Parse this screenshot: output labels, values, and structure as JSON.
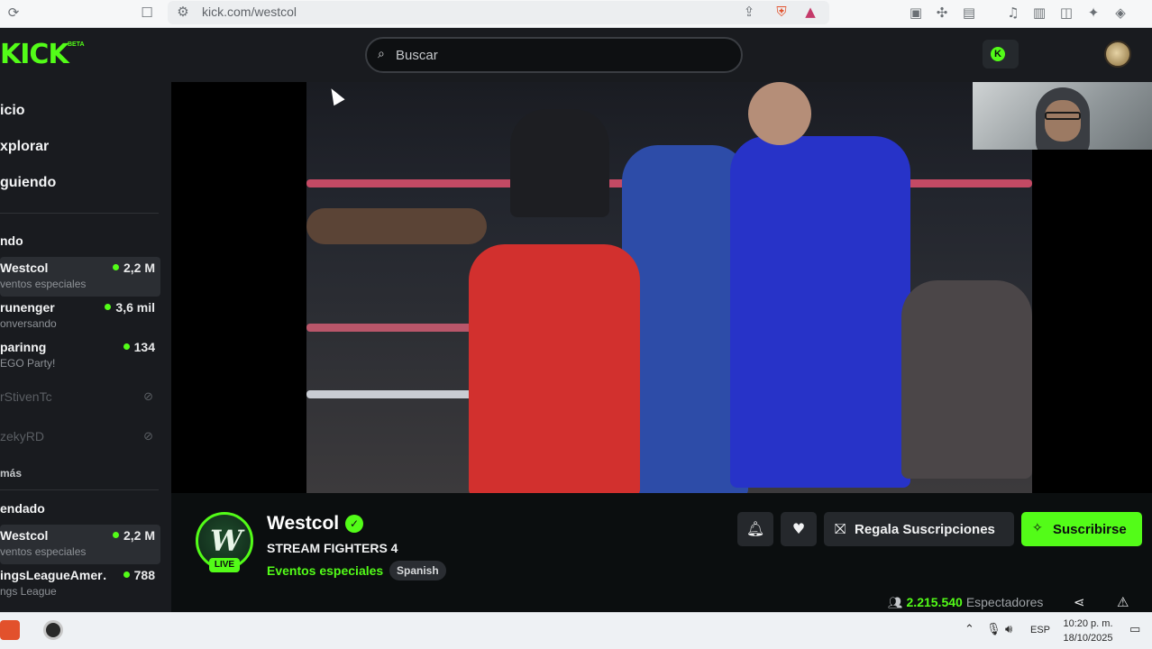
{
  "browser": {
    "url": "kick.com/westcol",
    "icons": [
      "reload-icon",
      "bookmark-icon",
      "site-settings-icon",
      "share-icon",
      "brave-shields-icon",
      "brave-rewards-icon",
      "extension-icon",
      "puzzle-icon",
      "reader-icon",
      "music-icon",
      "sidebar-icon",
      "wallet-icon",
      "leo-icon",
      "vpn-icon"
    ]
  },
  "header": {
    "logo": "KICK",
    "logo_badge": "BETA",
    "search_placeholder": "Buscar"
  },
  "sidebar": {
    "nav": [
      "icio",
      "xplorar",
      "guiendo"
    ],
    "following_title": "ndo",
    "following": [
      {
        "name": "Westcol",
        "category": "ventos especiales",
        "viewers": "2,2 M",
        "live": true,
        "active": true
      },
      {
        "name": "runenger",
        "category": "onversando",
        "viewers": "3,6 mil",
        "live": true
      },
      {
        "name": "parinng",
        "category": "EGO Party!",
        "viewers": "134",
        "live": true
      },
      {
        "name": "rStivenTc",
        "live": false
      },
      {
        "name": "zekyRD",
        "live": false
      }
    ],
    "more_label": "más",
    "recommended_title": "endado",
    "recommended": [
      {
        "name": "Westcol",
        "category": "ventos especiales",
        "viewers": "2,2 M",
        "live": true,
        "active": true
      },
      {
        "name": "ingsLeagueAmer…",
        "category": "ngs League",
        "viewers": "788",
        "live": true
      }
    ]
  },
  "stream": {
    "channel": "Westcol",
    "avatar_letter": "W",
    "live_badge": "LIVE",
    "title": "STREAM FIGHTERS 4",
    "category": "Eventos especiales",
    "language": "Spanish",
    "gift_label": "Regala Suscripciones",
    "subscribe_label": "Suscribirse",
    "viewers": "2.215.540",
    "viewers_label": "Espectadores"
  },
  "taskbar": {
    "language": "ESP",
    "time": "10:20 p. m.",
    "date": "18/10/2025"
  },
  "colors": {
    "accent": "#53fc18",
    "sidebar_bg": "#191b1f",
    "page_bg": "#0b0e0f"
  }
}
